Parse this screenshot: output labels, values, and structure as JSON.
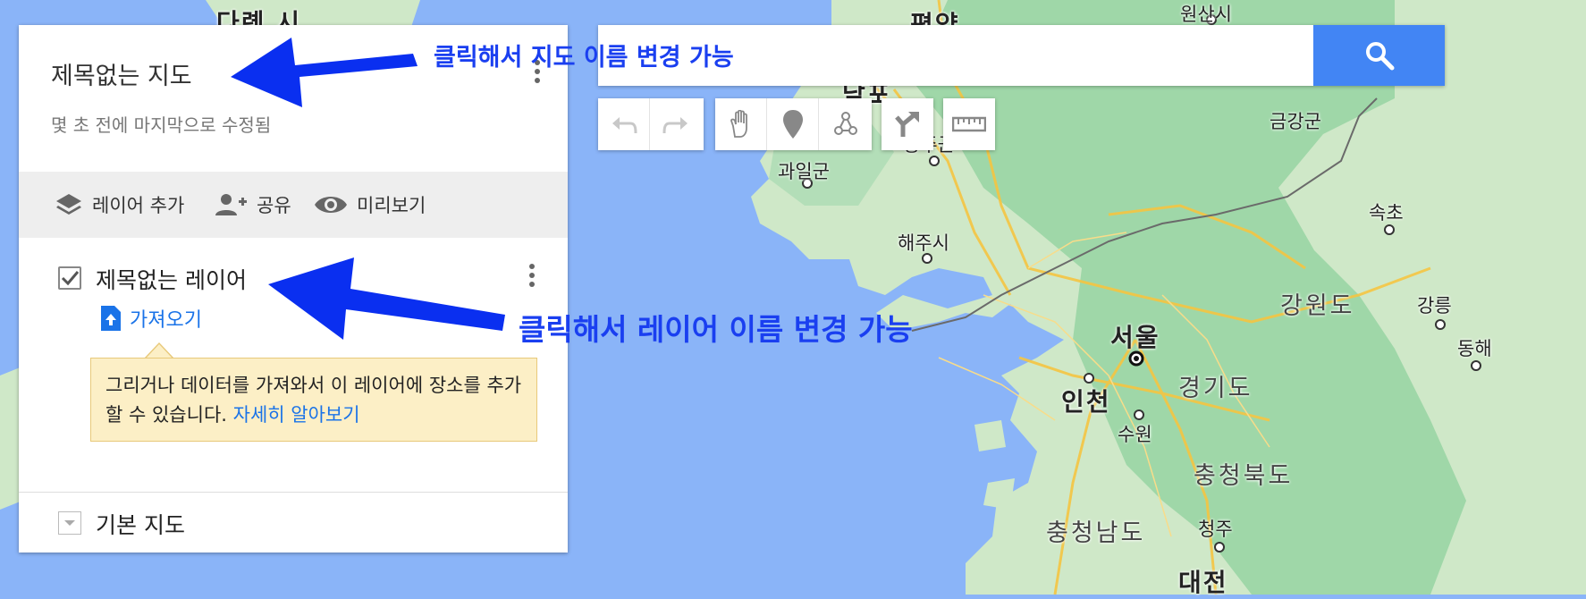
{
  "map": {
    "places": [
      {
        "id": "place-daeryeon",
        "label": "다롄 시",
        "cls": "big"
      },
      {
        "id": "place-pyongyang",
        "label": "평양",
        "cls": "big"
      },
      {
        "id": "place-wonsan",
        "label": "원산시",
        "cls": ""
      },
      {
        "id": "place-nampo",
        "label": "남포",
        "cls": "big"
      },
      {
        "id": "place-geumgang",
        "label": "금강군",
        "cls": ""
      },
      {
        "id": "place-gwail",
        "label": "과일군",
        "cls": ""
      },
      {
        "id": "place-hwangju",
        "label": "황주군",
        "cls": ""
      },
      {
        "id": "place-haeju",
        "label": "해주시",
        "cls": ""
      },
      {
        "id": "place-sokcho",
        "label": "속초",
        "cls": ""
      },
      {
        "id": "place-gangwon",
        "label": "강원도",
        "cls": "prov"
      },
      {
        "id": "place-gangneung",
        "label": "강릉",
        "cls": ""
      },
      {
        "id": "place-donghae",
        "label": "동해",
        "cls": ""
      },
      {
        "id": "place-seoul",
        "label": "서울",
        "cls": "big"
      },
      {
        "id": "place-incheon",
        "label": "인천",
        "cls": "big"
      },
      {
        "id": "place-gyeonggi",
        "label": "경기도",
        "cls": "prov"
      },
      {
        "id": "place-suwon",
        "label": "수원",
        "cls": ""
      },
      {
        "id": "place-chungbuk",
        "label": "충청북도",
        "cls": "prov"
      },
      {
        "id": "place-chungnam",
        "label": "충청남도",
        "cls": "prov"
      },
      {
        "id": "place-cheongju",
        "label": "청주",
        "cls": ""
      },
      {
        "id": "place-daejeon",
        "label": "대전",
        "cls": "big"
      }
    ]
  },
  "panel": {
    "title": "제목없는 지도",
    "subtitle": "몇 초 전에 마지막으로 수정됨",
    "toolbar": {
      "add_layer": "레이어 추가",
      "share": "공유",
      "preview": "미리보기"
    },
    "layer": {
      "name": "제목없는 레이어",
      "checked": true,
      "import_label": "가져오기"
    },
    "tip": {
      "text": "그리거나 데이터를 가져와서 이 레이어에 장소를 추가할 수 있습니다.",
      "link": "자세히 알아보기"
    },
    "base_map": "기본 지도"
  },
  "search": {
    "value": "",
    "placeholder": ""
  },
  "tools": [
    "undo-icon",
    "redo-icon",
    "hand-icon",
    "marker-icon",
    "draw-line-icon",
    "directions-icon",
    "ruler-icon"
  ],
  "annotations": {
    "map_title": "클릭해서 지도 이름 변경 가능",
    "layer_title": "클릭해서 레이어 이름 변경 가능"
  },
  "colors": {
    "annotation": "#1a3ff0",
    "water": "#8ab4f8",
    "land": "#cfe8c8",
    "search_button": "#4285f4",
    "tip_bg": "#fcefc6"
  }
}
